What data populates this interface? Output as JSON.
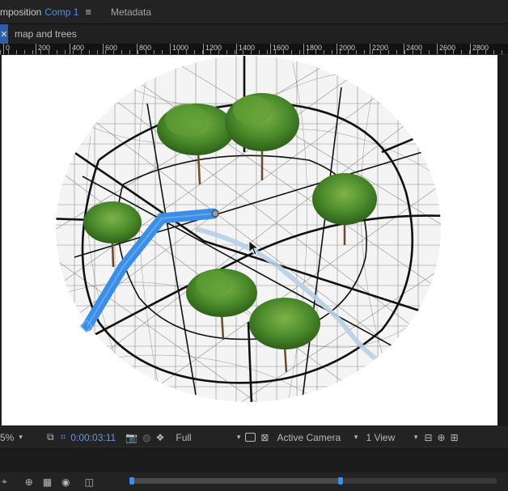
{
  "tabs": {
    "composition_prefix": "mposition",
    "composition_name": "Comp 1",
    "menu_icon": "hamburger-icon",
    "metadata": "Metadata"
  },
  "breadcrumb": {
    "close_icon": "close-icon",
    "item": "map and trees"
  },
  "ruler": {
    "ticks": [
      "0",
      "200",
      "400",
      "600",
      "800",
      "1000",
      "1200",
      "1400",
      "1600",
      "1800",
      "2000",
      "2200",
      "2400",
      "2600",
      "2800"
    ]
  },
  "viewer_controls": {
    "zoom": "5%",
    "timecode": "0:00:03:11",
    "resolution": "Full",
    "camera": "Active Camera",
    "views": "1 View"
  },
  "colors": {
    "accent_blue": "#4f8fe6",
    "path_blue": "#3b8ee6",
    "tree_green": "#3f7d22",
    "timecode": "#6c98d8"
  }
}
